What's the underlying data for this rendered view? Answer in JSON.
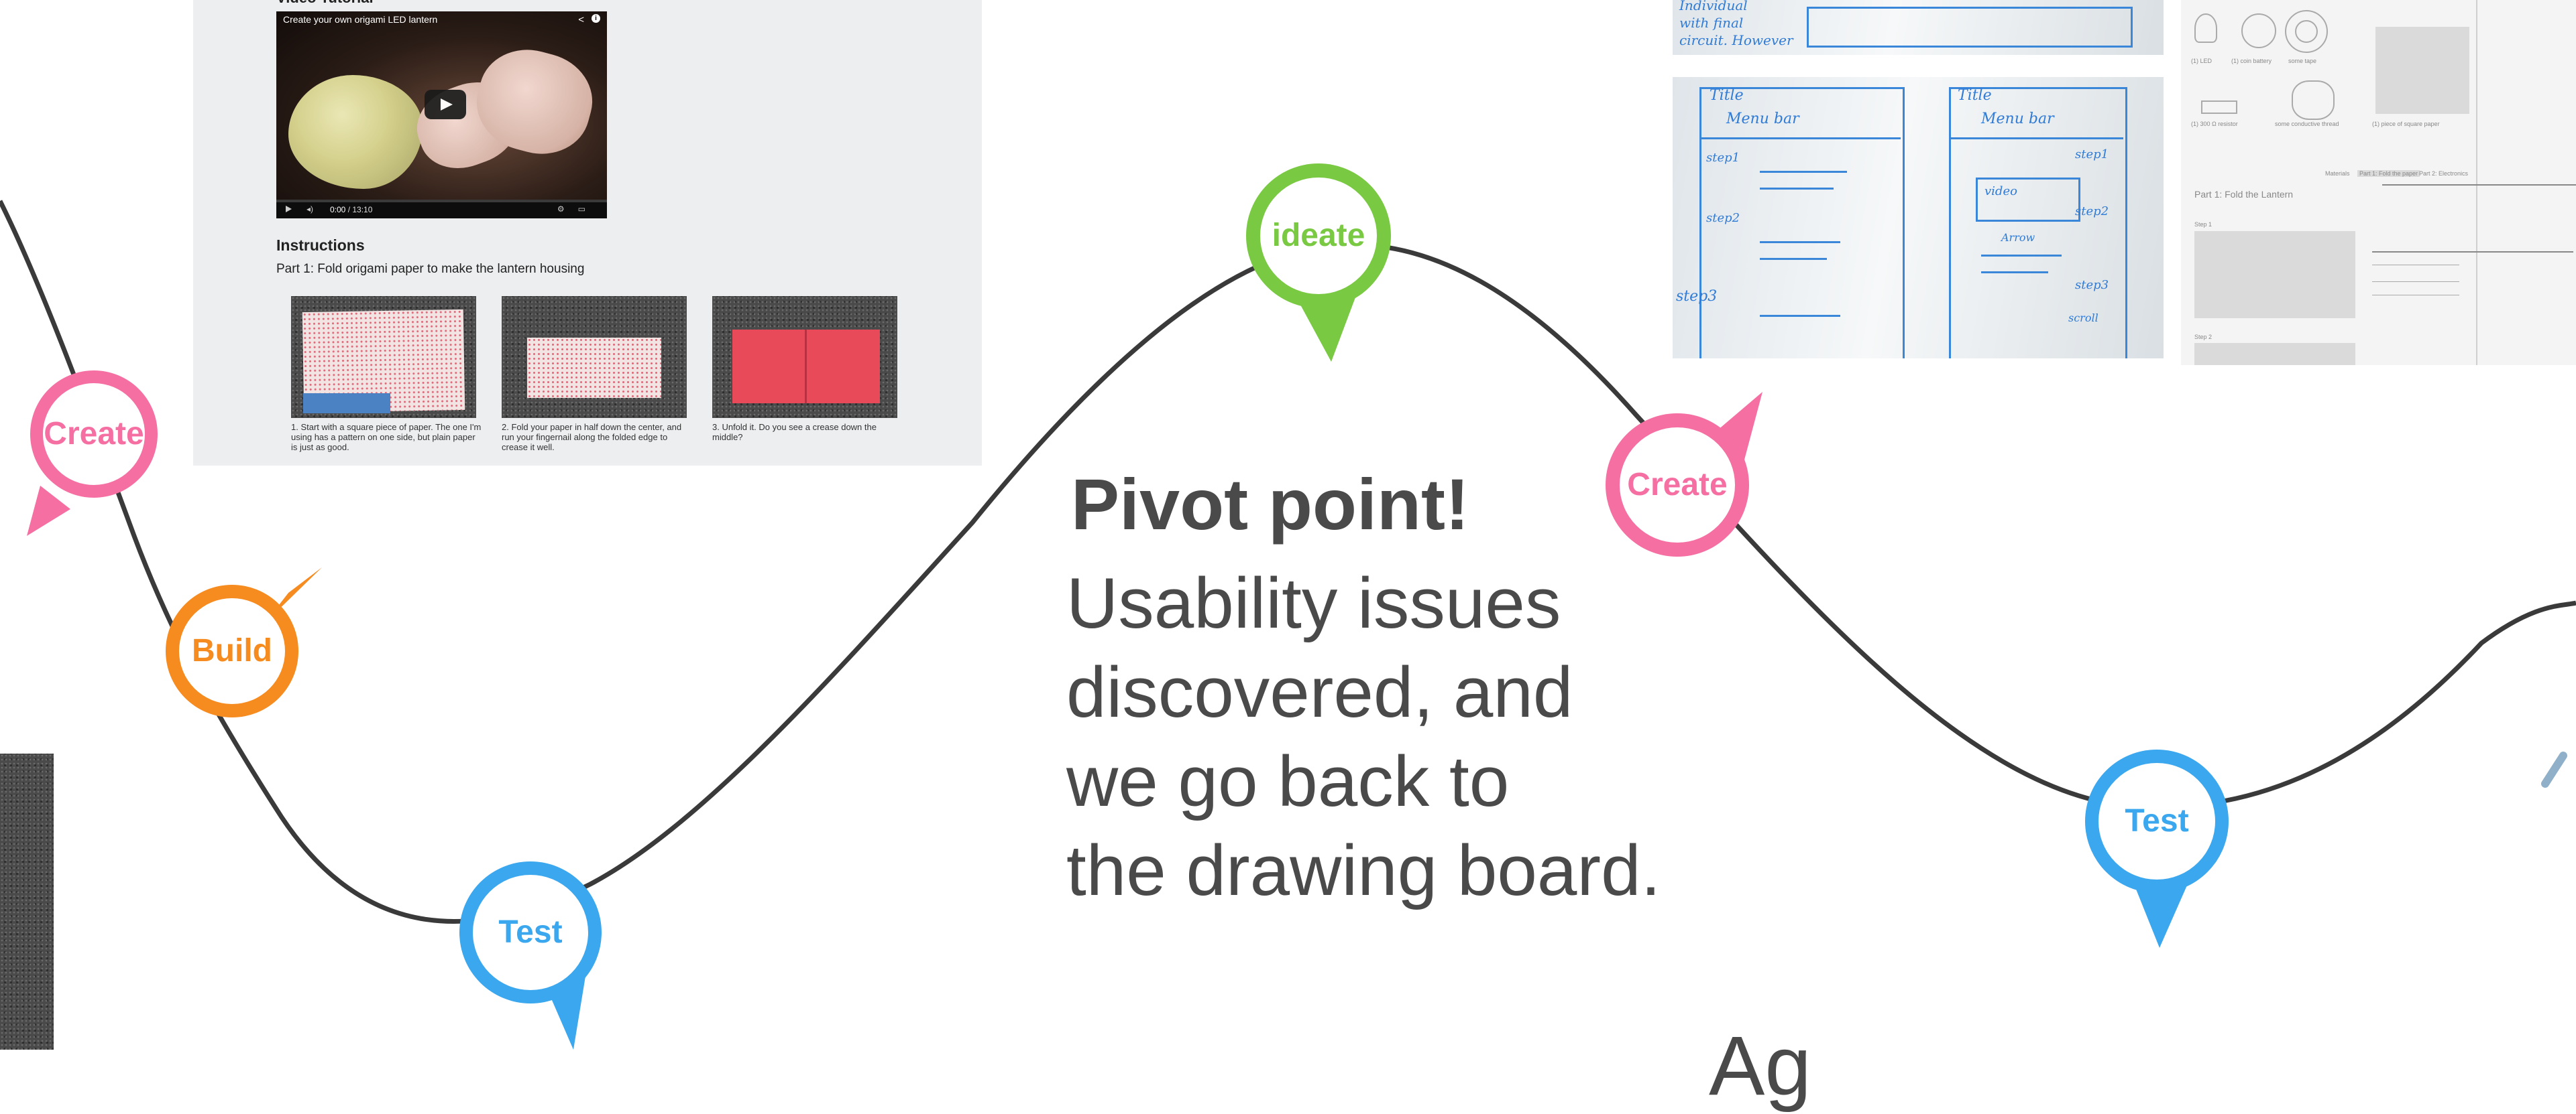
{
  "colors": {
    "create": "#f56fa3",
    "build": "#f68b1f",
    "test": "#3aa7ee",
    "ideate": "#7ac943",
    "curve": "#3a3a3a",
    "text": "#4a4a4a"
  },
  "markers": [
    {
      "label": "Create",
      "stage": "create"
    },
    {
      "label": "Build",
      "stage": "build"
    },
    {
      "label": "Test",
      "stage": "test"
    },
    {
      "label": "ideate",
      "stage": "ideate"
    },
    {
      "label": "Create",
      "stage": "create"
    },
    {
      "label": "Test",
      "stage": "test"
    }
  ],
  "callout": {
    "title": "Pivot point!",
    "lines": [
      "Usability issues",
      "discovered, and",
      "we go back to",
      "the drawing board."
    ]
  },
  "bottom_partial_text": "Ag",
  "tutorial": {
    "heading_partial": "Video Tutorial",
    "video": {
      "title": "Create your own origami LED lantern",
      "time_current": "0:00",
      "time_total": "13:10",
      "progress_fraction": 0.0
    },
    "instructions_heading": "Instructions",
    "part1_heading": "Part 1: Fold origami paper to make the lantern housing",
    "steps": [
      "1. Start with a square piece of paper. The one I'm using has a pattern on one side, but plain paper is just as good.",
      "2. Fold your paper in half down the center, and run your fingernail along the folded edge to crease it well.",
      "3. Unfold it. Do you see a crease down the middle?"
    ]
  },
  "whiteboard": {
    "top_note": [
      "Individual",
      "with final",
      "circuit. However"
    ],
    "left_sketch": [
      "Title",
      "Menu bar",
      "step1",
      "step2",
      "step3"
    ],
    "right_sketch": [
      "Title",
      "Menu bar",
      "step1",
      "step2",
      "step3",
      "video",
      "Arrow",
      "scroll"
    ]
  },
  "wireframe": {
    "materials": [
      "(1) LED",
      "(1) coin battery",
      "some tape",
      "(1) 300 Ω resistor",
      "some conductive thread",
      "(1) piece of square paper"
    ],
    "tabs": [
      "Materials",
      "Part 1: Fold the paper",
      "Part 2: Electronics"
    ],
    "part_heading": "Part 1: Fold the Lantern",
    "step1": "Step 1",
    "step2": "Step 2"
  }
}
